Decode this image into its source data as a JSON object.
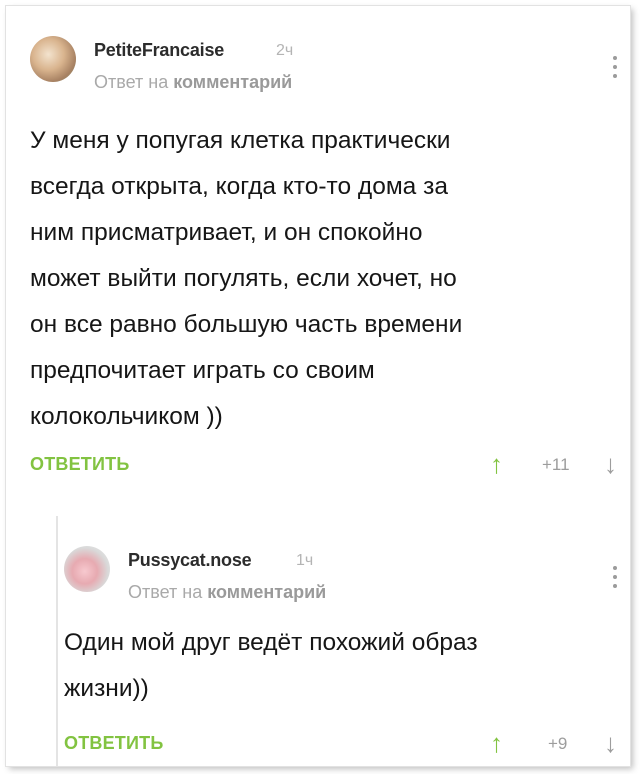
{
  "comments": [
    {
      "author": "PetiteFrancaise",
      "time": "2ч",
      "reply_prefix": "Ответ на",
      "reply_link": "комментарий",
      "text": "У меня у попугая клетка практически\nвсегда открыта, когда кто-то дома за\nним присматривает, и он спокойно\nможет выйти погулять, если хочет, но\nон все равно большую часть времени\nпредпочитает играть со своим\nколокольчиком ))",
      "reply_label": "ОТВЕТИТЬ",
      "score": "+11"
    },
    {
      "author": "Pussycat.nose",
      "time": "1ч",
      "reply_prefix": "Ответ на",
      "reply_link": "комментарий",
      "text": "Один мой друг ведёт похожий образ\nжизни))",
      "reply_label": "ОТВЕТИТЬ",
      "score": "+9"
    }
  ],
  "icons": {
    "upvote": "arrow-up-icon",
    "downvote": "arrow-down-icon",
    "more": "more-vertical-icon"
  },
  "colors": {
    "accent": "#82c341",
    "muted": "#9d9d9d"
  }
}
